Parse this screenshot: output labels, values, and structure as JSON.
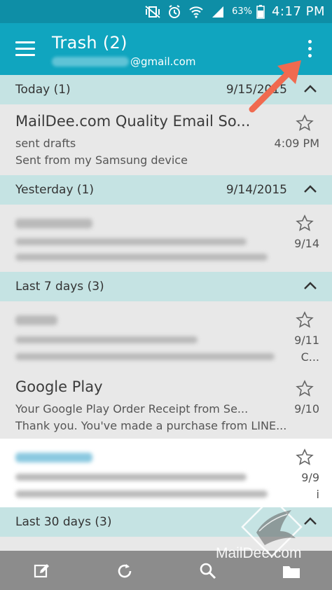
{
  "status_bar": {
    "battery": "63%",
    "time": "4:17 PM"
  },
  "app_bar": {
    "title": "Trash (2)",
    "account_suffix": "@gmail.com",
    "menu_icon": "hamburger-menu-icon",
    "overflow_icon": "more-vert-icon"
  },
  "sections": [
    {
      "label": "Today (1)",
      "date": "9/15/2015",
      "emails": [
        {
          "sender": "MailDee.com Quality Email So...",
          "subject": "sent drafts",
          "preview": "Sent from my Samsung device",
          "time": "4:09 PM",
          "blurred": false
        }
      ]
    },
    {
      "label": "Yesterday (1)",
      "date": "9/14/2015",
      "emails": [
        {
          "time": "9/14",
          "blurred": true
        }
      ]
    },
    {
      "label": "Last 7 days (3)",
      "date": "",
      "emails": [
        {
          "time": "9/11",
          "extra": "C...",
          "blurred": true
        },
        {
          "sender": "Google Play",
          "subject": "Your Google Play Order Receipt from Se...",
          "preview": "Thank you. You've made a purchase from LINE...",
          "time": "9/10",
          "blurred": false
        },
        {
          "time": "9/9",
          "extra": "i",
          "blurred": true
        }
      ]
    },
    {
      "label": "Last 30 days (3)",
      "date": ""
    }
  ],
  "bottom_bar": {
    "buttons": [
      "compose-icon",
      "refresh-icon",
      "search-icon",
      "folder-icon"
    ]
  },
  "watermark": {
    "text": "MailDee.com"
  },
  "colors": {
    "status_bar": "#0e8ea6",
    "app_bar": "#10a5bf",
    "section_header": "#c5e3e3",
    "annotation_arrow": "#f06a4f"
  }
}
